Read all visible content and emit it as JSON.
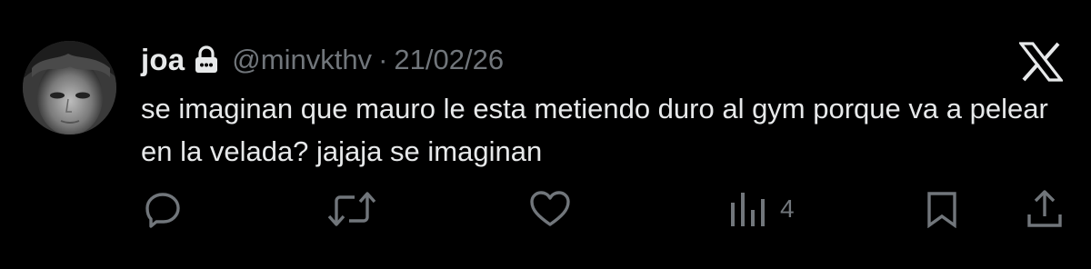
{
  "tweet": {
    "display_name": "joa",
    "handle": "@minvkthv",
    "separator": "·",
    "date": "21/02/26",
    "text": "se imaginan que mauro le esta metiendo duro al gym porque va a pelear en la velada? jajaja se imaginan",
    "views_count": "4"
  },
  "icons": {
    "lock": "lock-icon",
    "brand": "x-logo-icon",
    "reply": "reply-icon",
    "retweet": "retweet-icon",
    "like": "like-icon",
    "views": "views-icon",
    "bookmark": "bookmark-icon",
    "share": "share-icon"
  },
  "colors": {
    "background": "#000000",
    "primary_text": "#e7e9ea",
    "secondary_text": "#71767b"
  }
}
